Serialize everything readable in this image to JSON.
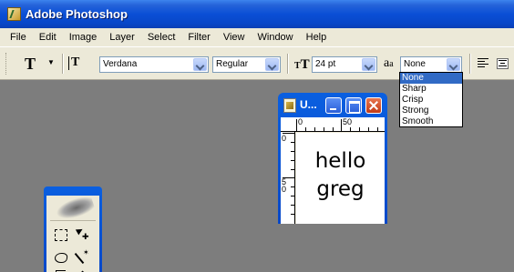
{
  "titlebar": {
    "title": "Adobe Photoshop"
  },
  "menu": [
    "File",
    "Edit",
    "Image",
    "Layer",
    "Select",
    "Filter",
    "View",
    "Window",
    "Help"
  ],
  "options": {
    "tool_glyph": "T",
    "font_family": "Verdana",
    "font_style": "Regular",
    "font_size": "24 pt",
    "antialias": "None",
    "antialias_options": [
      "None",
      "Sharp",
      "Crisp",
      "Strong",
      "Smooth"
    ]
  },
  "document": {
    "title": "U...",
    "ruler_top": [
      "0",
      "50"
    ],
    "ruler_left": [
      "0",
      "5",
      "0"
    ],
    "text_lines": [
      "hello",
      "greg"
    ]
  },
  "colors": {
    "titlebar": "#0a4fd6",
    "workspace": "#7d7d7d",
    "selection": "#316ac5"
  }
}
